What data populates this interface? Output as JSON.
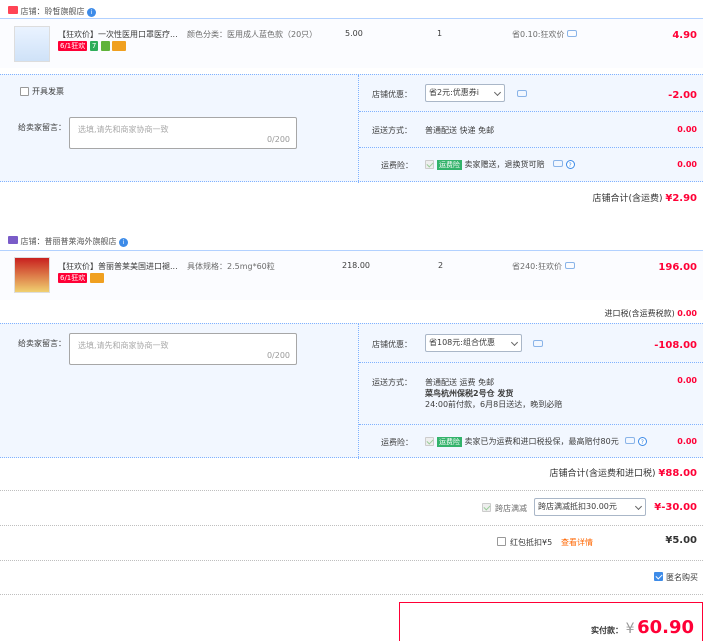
{
  "shop1": {
    "label": "店铺：聆皙旗舰店",
    "item": {
      "title": "【狂欢价】一次性医用口罩医疗...",
      "badge_61": "6/1狂欢",
      "badge_7": "7",
      "spec": "颜色分类：医用成人蓝色款（20只）",
      "price": "5.00",
      "qty": "1",
      "discount": "省0.10:狂欢价",
      "subtotal": "4.90"
    },
    "invoice_label": "开具发票",
    "memo_label": "给卖家留言：",
    "memo_placeholder": "选填,请先和商家协商一致",
    "memo_counter": "0/200",
    "coupon_label": "店铺优惠：",
    "coupon_value": "省2元:优惠券i",
    "coupon_amount": "-2.00",
    "ship_label": "运送方式：",
    "ship_value": "普通配送 快递 免邮",
    "ship_amount": "0.00",
    "insure_label": "运费险：",
    "insure_tag": "运费险",
    "insure_text": "卖家赠送，退换货可赔",
    "insure_amount": "0.00",
    "total_label": "店铺合计(含运费)",
    "total_value": "¥2.90"
  },
  "shop2": {
    "label": "店铺：普丽普莱海外旗舰店",
    "item": {
      "title": "【狂欢价】普丽普莱美国进口褪...",
      "badge_61": "6/1狂欢",
      "spec": "具体规格：2.5mg*60粒",
      "price": "218.00",
      "qty": "2",
      "discount": "省240:狂欢价",
      "subtotal": "196.00"
    },
    "tax_label": "进口税(含运费税款)",
    "tax_value": "0.00",
    "memo_label": "给卖家留言：",
    "memo_placeholder": "选填,请先和商家协商一致",
    "memo_counter": "0/200",
    "coupon_label": "店铺优惠：",
    "coupon_value": "省108元:组合优惠",
    "coupon_amount": "-108.00",
    "ship_label": "运送方式：",
    "ship_line1": "普通配送 运费 免邮",
    "ship_line2": "菜鸟杭州保税2号仓  发货",
    "ship_line3": "24:00前付款，6月8日送达，晚到必赔",
    "ship_amount": "0.00",
    "insure_label": "运费险：",
    "insure_tag": "运费险",
    "insure_text": "卖家已为运费和进口税投保，最高赔付80元",
    "insure_amount": "0.00",
    "total_label": "店铺合计(含运费和进口税)",
    "total_value": "¥88.00"
  },
  "cross_shop": {
    "label": "跨店满减",
    "select": "跨店满减抵扣30.00元",
    "amount": "¥-30.00"
  },
  "red_packet": {
    "label": "红包抵扣¥5",
    "link": "查看详情",
    "amount": "¥5.00"
  },
  "anonymous": {
    "label": "匿名购买"
  },
  "pay": {
    "label": "实付款：",
    "currency": "¥",
    "amount": "60.90"
  },
  "colors": {
    "accent_red": "#ff0036",
    "blue": "#3d8be8",
    "row_bg": "#f2f7ff"
  },
  "icons": [
    "shop-tag-icon",
    "info-icon",
    "chat-icon",
    "chevron-down-icon",
    "help-icon",
    "checkbox-icon"
  ]
}
